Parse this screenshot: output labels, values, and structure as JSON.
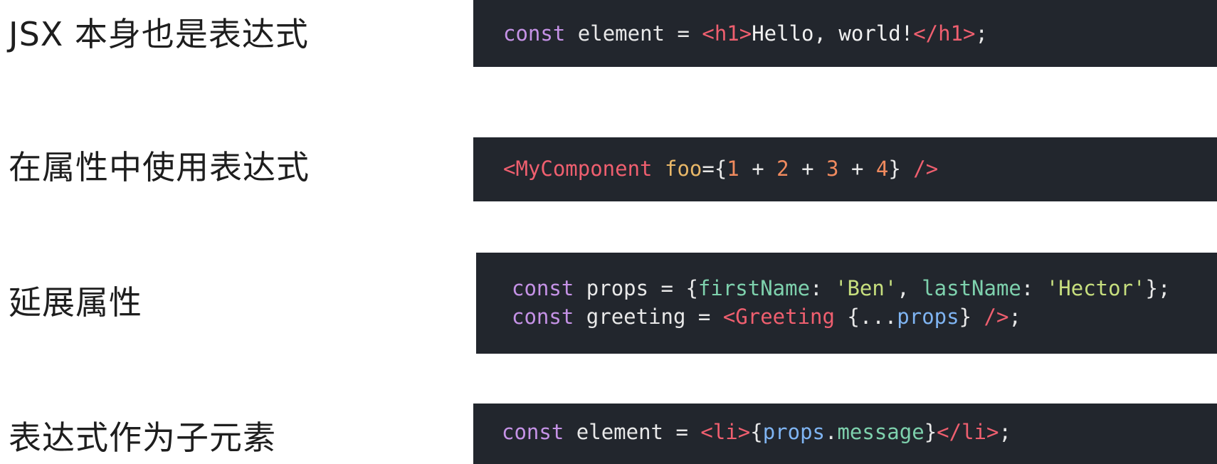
{
  "sections": [
    {
      "label": "JSX 本身也是表达式",
      "code": [
        [
          {
            "t": "kw",
            "v": "const"
          },
          {
            "t": "plain",
            "v": " element = "
          },
          {
            "t": "tag",
            "v": "<h1>"
          },
          {
            "t": "text",
            "v": "Hello, world!"
          },
          {
            "t": "tag",
            "v": "</h1>"
          },
          {
            "t": "plain",
            "v": ";"
          }
        ]
      ]
    },
    {
      "label": "在属性中使用表达式",
      "code": [
        [
          {
            "t": "tag",
            "v": "<MyComponent"
          },
          {
            "t": "plain",
            "v": " "
          },
          {
            "t": "attr",
            "v": "foo"
          },
          {
            "t": "plain",
            "v": "={"
          },
          {
            "t": "num",
            "v": "1"
          },
          {
            "t": "plain",
            "v": " + "
          },
          {
            "t": "num",
            "v": "2"
          },
          {
            "t": "plain",
            "v": " + "
          },
          {
            "t": "num",
            "v": "3"
          },
          {
            "t": "plain",
            "v": " + "
          },
          {
            "t": "num",
            "v": "4"
          },
          {
            "t": "plain",
            "v": "} "
          },
          {
            "t": "tag",
            "v": "/>"
          }
        ]
      ]
    },
    {
      "label": "延展属性",
      "code": [
        [
          {
            "t": "kw",
            "v": "const"
          },
          {
            "t": "plain",
            "v": " props = {"
          },
          {
            "t": "prop",
            "v": "firstName"
          },
          {
            "t": "plain",
            "v": ": "
          },
          {
            "t": "str",
            "v": "'Ben'"
          },
          {
            "t": "plain",
            "v": ", "
          },
          {
            "t": "prop",
            "v": "lastName"
          },
          {
            "t": "plain",
            "v": ": "
          },
          {
            "t": "str",
            "v": "'Hector'"
          },
          {
            "t": "plain",
            "v": "};"
          }
        ],
        [
          {
            "t": "kw",
            "v": "const"
          },
          {
            "t": "plain",
            "v": " greeting = "
          },
          {
            "t": "tag",
            "v": "<Greeting"
          },
          {
            "t": "plain",
            "v": " {..."
          },
          {
            "t": "var",
            "v": "props"
          },
          {
            "t": "plain",
            "v": "} "
          },
          {
            "t": "tag",
            "v": "/>"
          },
          {
            "t": "plain",
            "v": ";"
          }
        ]
      ]
    },
    {
      "label": "表达式作为子元素",
      "code": [
        [
          {
            "t": "kw",
            "v": "const"
          },
          {
            "t": "plain",
            "v": " element = "
          },
          {
            "t": "tag",
            "v": "<li>"
          },
          {
            "t": "plain",
            "v": "{"
          },
          {
            "t": "var",
            "v": "props"
          },
          {
            "t": "plain",
            "v": "."
          },
          {
            "t": "prop",
            "v": "message"
          },
          {
            "t": "plain",
            "v": "}"
          },
          {
            "t": "tag",
            "v": "</li>"
          },
          {
            "t": "plain",
            "v": ";"
          }
        ]
      ]
    }
  ]
}
